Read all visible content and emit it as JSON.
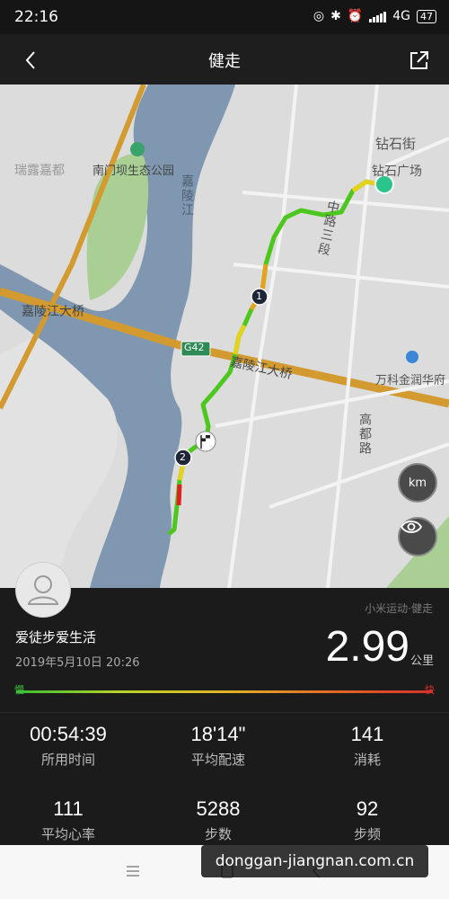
{
  "status": {
    "time": "22:16",
    "network": "4G",
    "battery": "47"
  },
  "header": {
    "title": "健走"
  },
  "map": {
    "labels": {
      "street_top": "钻石街",
      "plaza": "钻石广场",
      "park": "南门坝生态公园",
      "area_left": "瑞露嘉都",
      "river": "嘉陵江",
      "bridge_left": "嘉陵江大桥",
      "bridge_center": "嘉陵江大桥",
      "highway_badge": "G42",
      "road_right": "中路三段",
      "poi_right": "万科金润华府",
      "area_bottom_right": "高都路"
    },
    "markers": {
      "lap1": "1",
      "lap2": "2"
    },
    "km_button": "km"
  },
  "summary": {
    "source": "小米运动·健走",
    "username": "爱徒步爱生活",
    "datetime": "2019年5月10日 20:26",
    "distance": "2.99",
    "distance_unit": "公里",
    "pace_slow": "慢",
    "pace_fast": "快"
  },
  "stats": [
    {
      "value": "00:54:39",
      "label": "所用时间"
    },
    {
      "value": "18'14\"",
      "label": "平均配速"
    },
    {
      "value": "141",
      "label": "消耗"
    },
    {
      "value": "111",
      "label": "平均心率"
    },
    {
      "value": "5288",
      "label": "步数"
    },
    {
      "value": "92",
      "label": "步频"
    }
  ],
  "watermark": "donggan-jiangnan.com.cn",
  "colors": {
    "track_green": "#4cc71d",
    "track_yellow": "#e5d21b",
    "track_red": "#e21f1f",
    "start_dot": "#2bc48a",
    "river": "#7f97b0",
    "highway": "#d39a2f"
  }
}
